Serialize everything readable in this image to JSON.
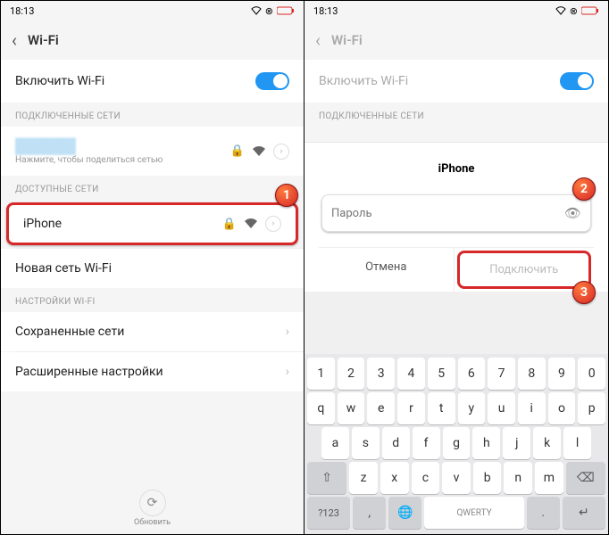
{
  "statusbar": {
    "time": "18:13"
  },
  "left": {
    "title": "Wi-Fi",
    "enable_label": "Включить Wi-Fi",
    "section_connected": "ПОДКЛЮЧЕННЫЕ СЕТИ",
    "connected_hint": "Нажмите, чтобы поделиться сетью",
    "section_available": "ДОСТУПНЫЕ СЕТИ",
    "available": [
      {
        "name": "iPhone"
      }
    ],
    "new_network": "Новая сеть Wi-Fi",
    "section_settings": "НАСТРОЙКИ WI-FI",
    "saved": "Сохраненные сети",
    "advanced": "Расширенные настройки",
    "refresh": "Обновить"
  },
  "right": {
    "title": "Wi-Fi",
    "enable_label": "Включить Wi-Fi",
    "section_connected": "ПОДКЛЮЧЕННЫЕ СЕТИ",
    "dialog": {
      "network": "iPhone",
      "password_placeholder": "Пароль",
      "cancel": "Отмена",
      "connect": "Подключить"
    },
    "kbd": {
      "r1": [
        "1",
        "2",
        "3",
        "4",
        "5",
        "6",
        "7",
        "8",
        "9",
        "0"
      ],
      "r2": [
        "q",
        "w",
        "e",
        "r",
        "t",
        "y",
        "u",
        "i",
        "o",
        "p"
      ],
      "r3": [
        "a",
        "s",
        "d",
        "f",
        "g",
        "h",
        "j",
        "k",
        "l"
      ],
      "r4": [
        "z",
        "x",
        "c",
        "v",
        "b",
        "n",
        "m"
      ],
      "sym": "?123",
      "layout": "QWERTY"
    }
  },
  "badges": {
    "b1": "1",
    "b2": "2",
    "b3": "3"
  }
}
